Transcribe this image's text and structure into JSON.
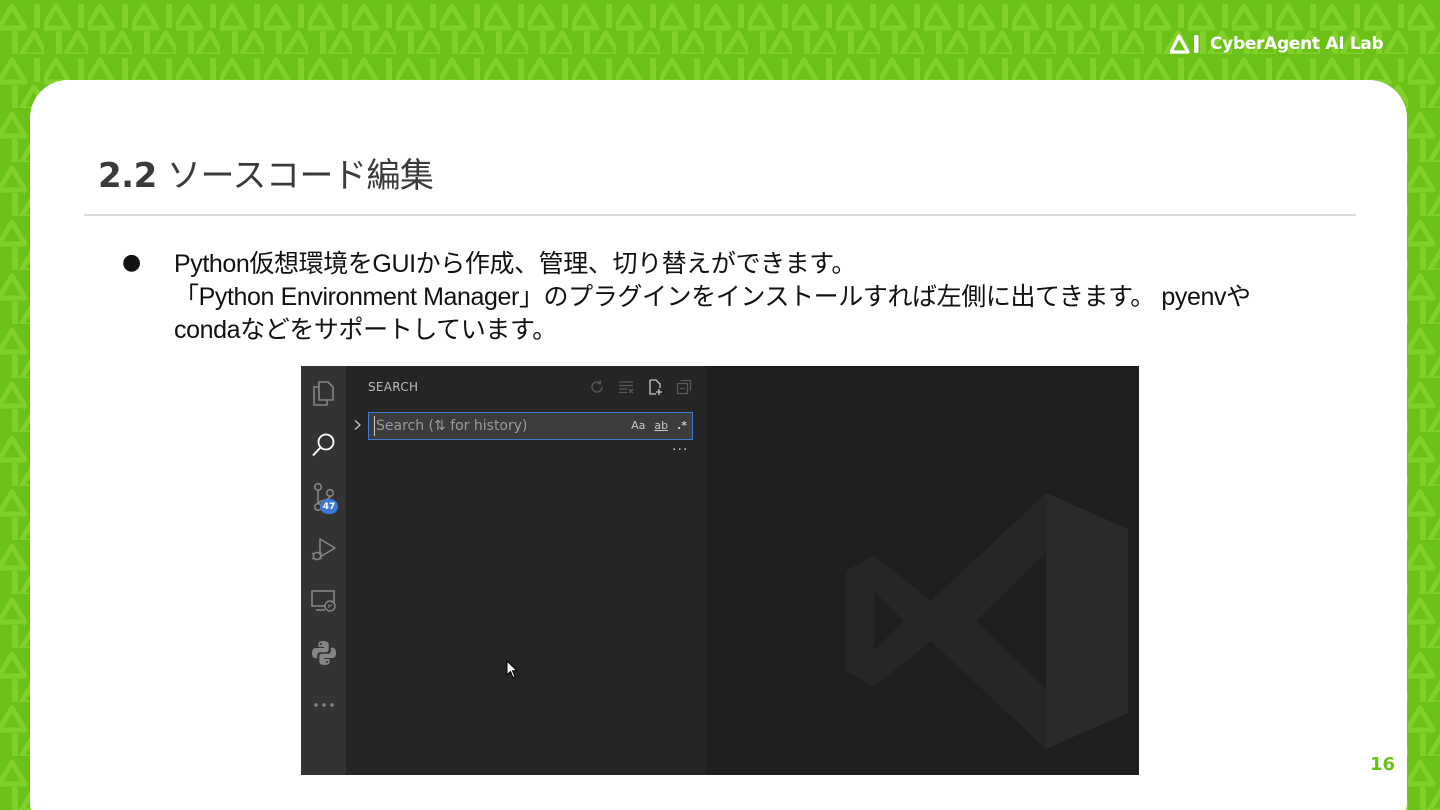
{
  "brand": {
    "name": "CyberAgent AI Lab"
  },
  "slide": {
    "title_number": "2.2",
    "title_text": "ソースコード編集",
    "bullet": "●",
    "lines": [
      "Python仮想環境をGUIから作成、管理、切り替えができます。",
      "「Python Environment Manager」のプラグインをインストールすれば左側に出てきます。 pyenvや",
      "condaなどをサポートしています。"
    ],
    "page_number": "16"
  },
  "vscode": {
    "panel_title": "SEARCH",
    "search_placeholder": "Search (⇅ for history)",
    "search_options": [
      "Aa",
      "ab",
      ".*"
    ],
    "more": "···",
    "scm_badge": "47"
  },
  "colors": {
    "brand_green": "#6cc118",
    "activity_bar": "#333333",
    "side_panel": "#252526",
    "editor": "#1e1e1e",
    "focus_border": "#3f7bd1",
    "badge": "#3b78d8"
  },
  "icons": {
    "activity": [
      "files-icon",
      "search-icon",
      "source-control-icon",
      "run-debug-icon",
      "remote-explorer-icon",
      "python-icon",
      "more-icon"
    ],
    "panel_actions": [
      "refresh-icon",
      "clear-results-icon",
      "new-search-editor-icon",
      "collapse-all-icon"
    ]
  }
}
